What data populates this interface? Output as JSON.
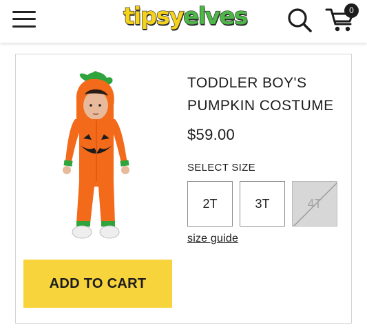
{
  "header": {
    "menu_icon": "hamburger-menu-icon",
    "logo": {
      "part1": "tipsy",
      "part2": "elves"
    },
    "search_icon": "search-icon",
    "cart_icon": "cart-icon",
    "cart_count": "0"
  },
  "product": {
    "title_line1": "TODDLER BOY'S",
    "title_line2": "PUMPKIN COSTUME",
    "price": "$59.00",
    "size_label": "SELECT SIZE",
    "sizes": [
      {
        "label": "2T",
        "available": true
      },
      {
        "label": "3T",
        "available": true
      },
      {
        "label": "4T",
        "available": false
      }
    ],
    "size_guide_label": "size guide",
    "add_to_cart_label": "ADD TO CART",
    "image_icon": "toddler-pumpkin-costume-photo"
  },
  "colors": {
    "accent_yellow": "#f7d43b",
    "logo_yellow": "#f5d21b",
    "logo_green": "#4db848",
    "costume_orange": "#f36a1a",
    "costume_green": "#2fa33c"
  }
}
